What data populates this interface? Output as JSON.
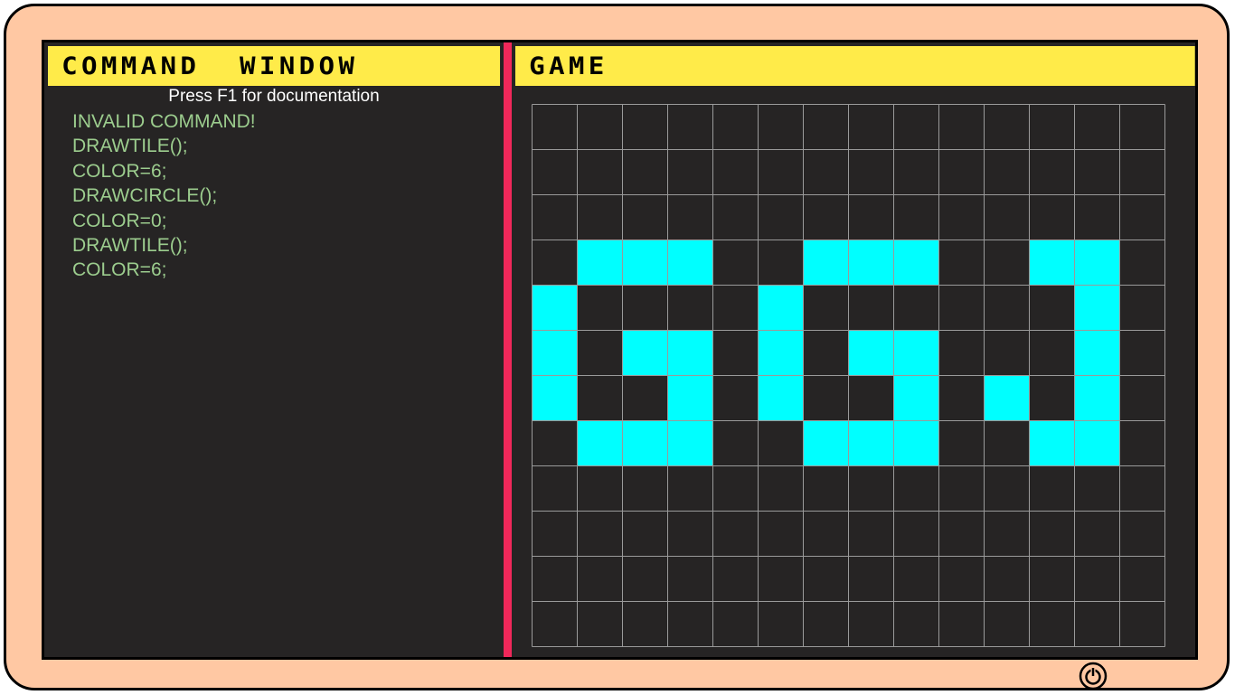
{
  "command_window": {
    "title": "COMMAND  WINDOW",
    "hint": "Press F1 for documentation",
    "log": [
      "INVALID COMMAND!",
      "DRAWTILE();",
      "COLOR=6;",
      "DRAWCIRCLE();",
      "COLOR=0;",
      "DRAWTILE();",
      "COLOR=6;"
    ]
  },
  "game": {
    "title": "GAME",
    "grid": {
      "columns": 14,
      "rows": 12,
      "filled_color": "#00ffff",
      "grid_line_color": "#9a9a9a",
      "filled_cells": [
        [
          3,
          1
        ],
        [
          3,
          2
        ],
        [
          3,
          3
        ],
        [
          3,
          6
        ],
        [
          3,
          7
        ],
        [
          3,
          8
        ],
        [
          3,
          11
        ],
        [
          3,
          12
        ],
        [
          4,
          0
        ],
        [
          4,
          5
        ],
        [
          4,
          12
        ],
        [
          5,
          0
        ],
        [
          5,
          2
        ],
        [
          5,
          3
        ],
        [
          5,
          5
        ],
        [
          5,
          7
        ],
        [
          5,
          8
        ],
        [
          5,
          12
        ],
        [
          6,
          0
        ],
        [
          6,
          3
        ],
        [
          6,
          5
        ],
        [
          6,
          8
        ],
        [
          6,
          10
        ],
        [
          6,
          12
        ],
        [
          7,
          1
        ],
        [
          7,
          2
        ],
        [
          7,
          3
        ],
        [
          7,
          6
        ],
        [
          7,
          7
        ],
        [
          7,
          8
        ],
        [
          7,
          11
        ],
        [
          7,
          12
        ]
      ]
    }
  },
  "colors": {
    "bezel": "#ffc8a3",
    "screen": "#262424",
    "header": "#ffeb49",
    "divider": "#f0285a",
    "log_text": "#9ccd8e"
  },
  "icons": {
    "power": "power-icon"
  }
}
